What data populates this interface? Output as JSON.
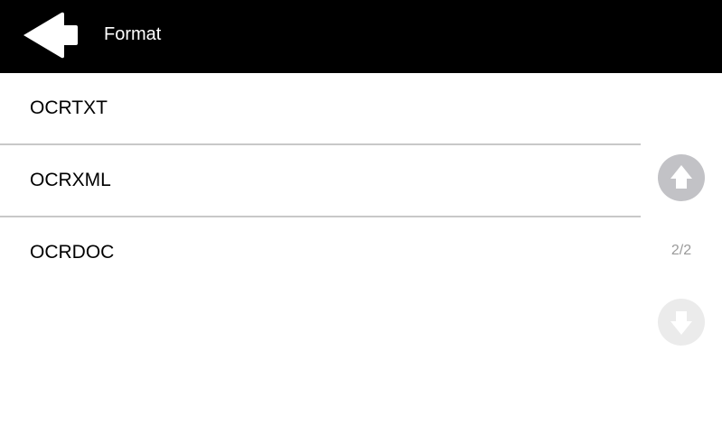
{
  "header": {
    "title": "Format",
    "back_icon": "back-arrow-icon"
  },
  "list": {
    "items": [
      {
        "label": "OCRTXT"
      },
      {
        "label": "OCRXML"
      },
      {
        "label": "OCRDOC"
      }
    ]
  },
  "pager": {
    "indicator": "2/2",
    "up_icon": "arrow-up-icon",
    "down_icon": "arrow-down-icon",
    "up_enabled": true,
    "down_enabled": false
  },
  "colors": {
    "header_bg": "#000000",
    "divider": "#c8c8c8",
    "scroll_up_active": "#c2c2c6",
    "scroll_down_disabled": "#ebebeb"
  }
}
